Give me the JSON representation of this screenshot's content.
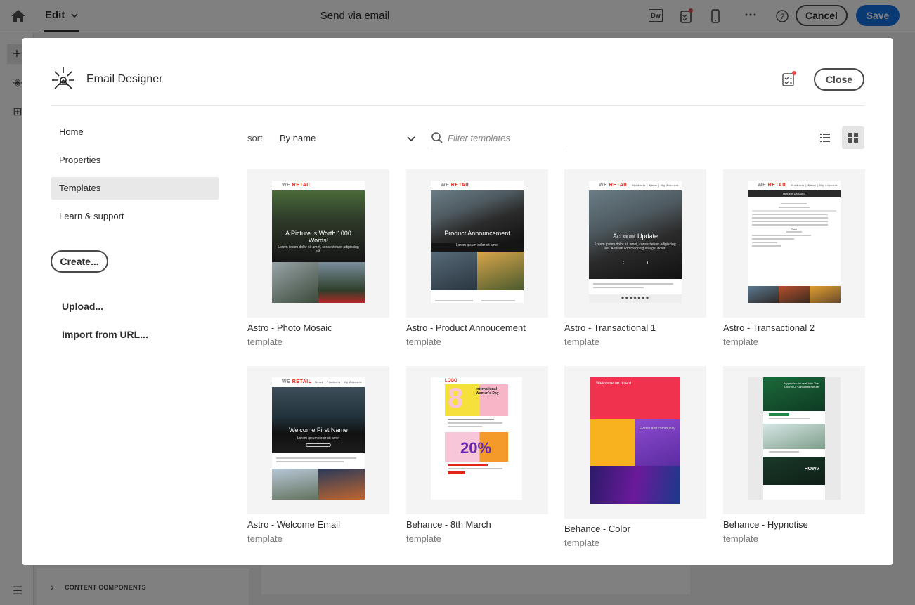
{
  "app": {
    "edit_label": "Edit",
    "title": "Send via email",
    "cancel_label": "Cancel",
    "save_label": "Save",
    "bottom_panel_label": "CONTENT COMPONENTS",
    "icons": [
      "home-icon",
      "dreamweaver-icon",
      "checklist-icon",
      "mobile-preview-icon",
      "more-icon",
      "help-icon"
    ]
  },
  "modal": {
    "title": "Email Designer",
    "close_label": "Close",
    "nav": [
      {
        "label": "Home"
      },
      {
        "label": "Properties"
      },
      {
        "label": "Templates",
        "active": true
      },
      {
        "label": "Learn & support"
      }
    ],
    "create_label": "Create...",
    "upload_label": "Upload...",
    "import_label": "Import from URL...",
    "sort": {
      "label": "sort",
      "value": "By name"
    },
    "search": {
      "placeholder": "Filter templates"
    },
    "templates": [
      {
        "name": "Astro - Photo Mosaic",
        "type": "template",
        "brand": "WE",
        "brand2": "RETAIL",
        "heading": "A Picture is Worth 1000 Words!",
        "sub": "Lorem ipsum dolor sit amet, consectetuer adipiscing elit."
      },
      {
        "name": "Astro - Product Annoucement",
        "type": "template",
        "brand": "WE",
        "brand2": "RETAIL",
        "heading": "Product Announcement",
        "sub": "Lorem ipsum dolor sit amet"
      },
      {
        "name": "Astro - Transactional 1",
        "type": "template",
        "brand": "WE",
        "brand2": "RETAIL",
        "heading": "Account Update",
        "sub": "Lorem ipsum dolor sit amet, consectetuer adipiscing elit. Aenean commodo ligula eget dolor."
      },
      {
        "name": "Astro - Transactional 2",
        "type": "template",
        "brand": "WE",
        "brand2": "RETAIL",
        "heading": "ORDER DETAILS",
        "sub": "Total"
      },
      {
        "name": "Astro - Welcome Email",
        "type": "template",
        "brand": "WE",
        "brand2": "RETAIL",
        "heading": "Welcome First Name",
        "sub": "Lorem ipsum dolor sit amet"
      },
      {
        "name": "Behance - 8th March",
        "type": "template",
        "brand": "LOGO",
        "brand2": "",
        "heading": "International Women's Day",
        "sub": "20%"
      },
      {
        "name": "Behance - Color",
        "type": "template",
        "brand": "",
        "brand2": "",
        "heading": "Welcome on board",
        "sub": "Events and community"
      },
      {
        "name": "Behance - Hypnotise",
        "type": "template",
        "brand": "",
        "brand2": "",
        "heading": "Hypnotize Yourself Into The Charm Of Christmas Future",
        "sub": "HOW?"
      }
    ]
  },
  "colors": {
    "accent": "#1473e6",
    "brand_red": "#e1251b",
    "notification_dot": "#e34850"
  }
}
